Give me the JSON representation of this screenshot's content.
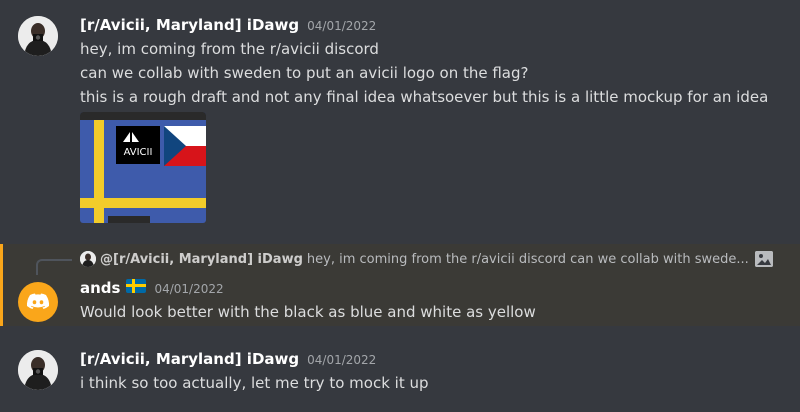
{
  "messages": [
    {
      "author": "[r/Avicii, Maryland] iDawg",
      "timestamp": "04/01/2022",
      "lines": [
        "hey, im coming from the r/avicii discord",
        "can we collab with sweden to put an avicii logo on the flag?",
        "this is a rough draft and not any final idea whatsoever but this is a little mockup for an idea"
      ],
      "attachment": {
        "logo_text": "AVICII"
      }
    },
    {
      "reply_to": {
        "author": "@[r/Avicii, Maryland] iDawg",
        "preview": "hey, im coming from the r/avicii discord can we collab with swede..."
      },
      "author": "ands",
      "author_emoji": "sweden-flag",
      "timestamp": "04/01/2022",
      "lines": [
        "Would look better with the black as blue and white as yellow"
      ],
      "highlight_color": "#faa61a"
    },
    {
      "author": "[r/Avicii, Maryland] iDawg",
      "timestamp": "04/01/2022",
      "lines": [
        "i think so too actually, let me try to mock it up"
      ]
    }
  ]
}
